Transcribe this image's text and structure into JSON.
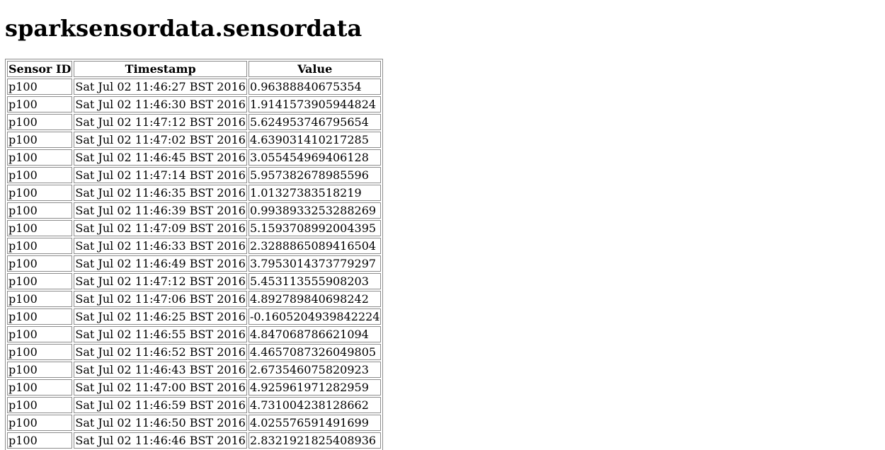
{
  "page": {
    "title": "sparksensordata.sensordata"
  },
  "table": {
    "headers": [
      "Sensor ID",
      "Timestamp",
      "Value"
    ],
    "rows": [
      [
        "p100",
        "Sat Jul 02 11:46:27 BST 2016",
        "0.96388840675354"
      ],
      [
        "p100",
        "Sat Jul 02 11:46:30 BST 2016",
        "1.9141573905944824"
      ],
      [
        "p100",
        "Sat Jul 02 11:47:12 BST 2016",
        "5.624953746795654"
      ],
      [
        "p100",
        "Sat Jul 02 11:47:02 BST 2016",
        "4.639031410217285"
      ],
      [
        "p100",
        "Sat Jul 02 11:46:45 BST 2016",
        "3.055454969406128"
      ],
      [
        "p100",
        "Sat Jul 02 11:47:14 BST 2016",
        "5.957382678985596"
      ],
      [
        "p100",
        "Sat Jul 02 11:46:35 BST 2016",
        "1.01327383518219"
      ],
      [
        "p100",
        "Sat Jul 02 11:46:39 BST 2016",
        "0.9938933253288269"
      ],
      [
        "p100",
        "Sat Jul 02 11:47:09 BST 2016",
        "5.1593708992004395"
      ],
      [
        "p100",
        "Sat Jul 02 11:46:33 BST 2016",
        "2.3288865089416504"
      ],
      [
        "p100",
        "Sat Jul 02 11:46:49 BST 2016",
        "3.7953014373779297"
      ],
      [
        "p100",
        "Sat Jul 02 11:47:12 BST 2016",
        "5.453113555908203"
      ],
      [
        "p100",
        "Sat Jul 02 11:47:06 BST 2016",
        "4.892789840698242"
      ],
      [
        "p100",
        "Sat Jul 02 11:46:25 BST 2016",
        "-0.1605204939842224"
      ],
      [
        "p100",
        "Sat Jul 02 11:46:55 BST 2016",
        "4.847068786621094"
      ],
      [
        "p100",
        "Sat Jul 02 11:46:52 BST 2016",
        "4.4657087326049805"
      ],
      [
        "p100",
        "Sat Jul 02 11:46:43 BST 2016",
        "2.673546075820923"
      ],
      [
        "p100",
        "Sat Jul 02 11:47:00 BST 2016",
        "4.925961971282959"
      ],
      [
        "p100",
        "Sat Jul 02 11:46:59 BST 2016",
        "4.731004238128662"
      ],
      [
        "p100",
        "Sat Jul 02 11:46:50 BST 2016",
        "4.025576591491699"
      ],
      [
        "p100",
        "Sat Jul 02 11:46:46 BST 2016",
        "2.8321921825408936"
      ]
    ]
  }
}
